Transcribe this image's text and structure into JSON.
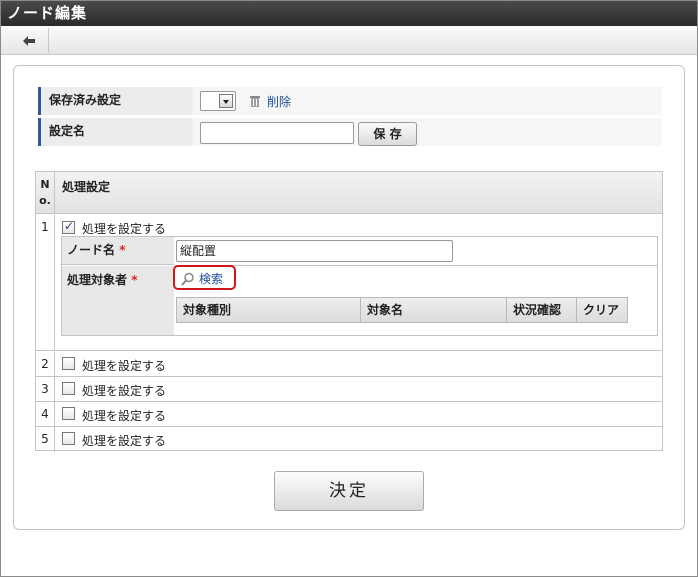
{
  "window": {
    "title": "ノード編集"
  },
  "toolbar": {
    "back_icon": "arrow-left-icon"
  },
  "settings": {
    "saved_label": "保存済み設定",
    "delete_label": "削除",
    "name_label": "設定名",
    "name_value": "",
    "save_button": "保 存"
  },
  "table": {
    "col_no": "N\no.",
    "col_title": "処理設定",
    "rows": [
      {
        "num": "1",
        "checked": true,
        "label": "処理を設定する"
      },
      {
        "num": "2",
        "checked": false,
        "label": "処理を設定する"
      },
      {
        "num": "3",
        "checked": false,
        "label": "処理を設定する"
      },
      {
        "num": "4",
        "checked": false,
        "label": "処理を設定する"
      },
      {
        "num": "5",
        "checked": false,
        "label": "処理を設定する"
      }
    ],
    "detail": {
      "node_name_label": "ノード名",
      "node_name_value": "縦配置",
      "target_label": "処理対象者",
      "required_mark": "*",
      "search_label": "検索",
      "columns": [
        "対象種別",
        "対象名",
        "状況確認",
        "クリア"
      ]
    }
  },
  "decide_button": "決定",
  "colors": {
    "accent": "#2f5a96",
    "highlight": "#d01818"
  }
}
